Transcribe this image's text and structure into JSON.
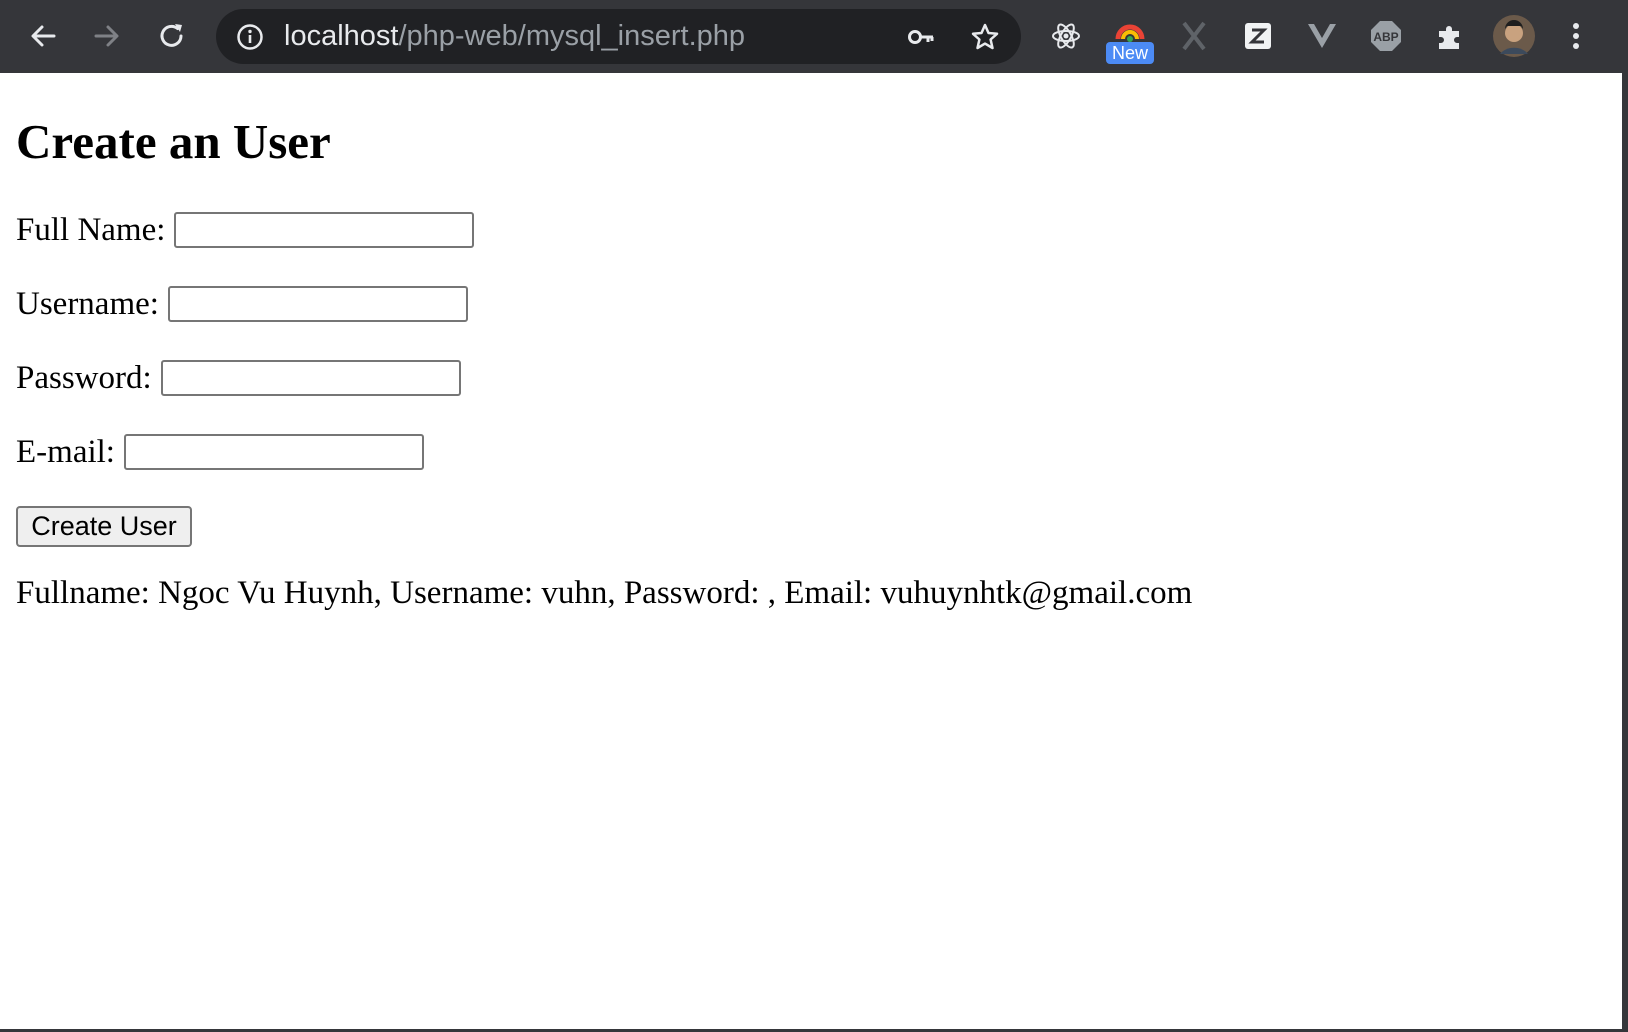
{
  "browser": {
    "url_host": "localhost",
    "url_path": "/php-web/mysql_insert.php",
    "extension_badge": "New",
    "extensions": [
      "react-icon",
      "color-extension-icon",
      "x-icon",
      "zotero-icon",
      "vue-icon",
      "abp-icon",
      "puzzle-icon",
      "avatar",
      "more-icon"
    ]
  },
  "page": {
    "title": "Create an User",
    "fields": [
      {
        "label": "Full Name:",
        "value": ""
      },
      {
        "label": "Username:",
        "value": ""
      },
      {
        "label": "Password:",
        "value": ""
      },
      {
        "label": "E-mail:",
        "value": ""
      }
    ],
    "submit_label": "Create User",
    "result_text": "Fullname: Ngoc Vu Huynh, Username: vuhn, Password: , Email: vuhuynhtk@gmail.com"
  },
  "colors": {
    "toolbar_bg": "#35363a",
    "omnibox_bg": "#202124",
    "badge_blue": "#4c8bf5"
  }
}
